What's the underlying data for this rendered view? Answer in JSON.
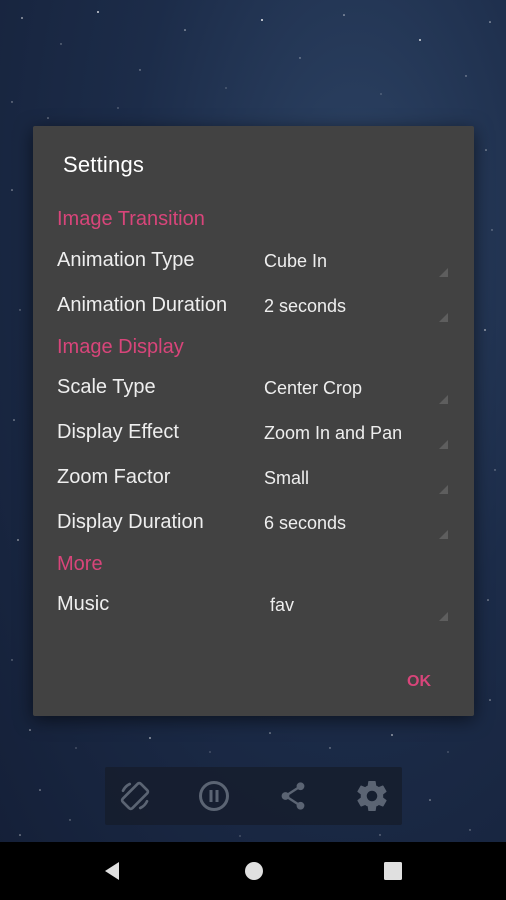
{
  "dialog": {
    "title": "Settings",
    "ok_label": "OK",
    "sections": {
      "transition": {
        "header": "Image Transition",
        "animation_type": {
          "label": "Animation Type",
          "value": "Cube In"
        },
        "animation_duration": {
          "label": "Animation Duration",
          "value": "2 seconds"
        }
      },
      "display": {
        "header": "Image Display",
        "scale_type": {
          "label": "Scale Type",
          "value": "Center Crop"
        },
        "display_effect": {
          "label": "Display Effect",
          "value": "Zoom In and Pan"
        },
        "zoom_factor": {
          "label": "Zoom Factor",
          "value": "Small"
        },
        "display_duration": {
          "label": "Display Duration",
          "value": "6 seconds"
        }
      },
      "more": {
        "header": "More",
        "music": {
          "label": "Music",
          "value": "fav"
        }
      }
    }
  },
  "toolbar": {
    "items": [
      "screen-rotation-icon",
      "pause-icon",
      "share-icon",
      "gear-icon"
    ]
  },
  "navbar": {
    "items": [
      "back-icon",
      "home-icon",
      "recents-icon"
    ]
  },
  "colors": {
    "accent": "#d8457a",
    "dialog_bg": "#424242",
    "text": "#eeeeee"
  }
}
